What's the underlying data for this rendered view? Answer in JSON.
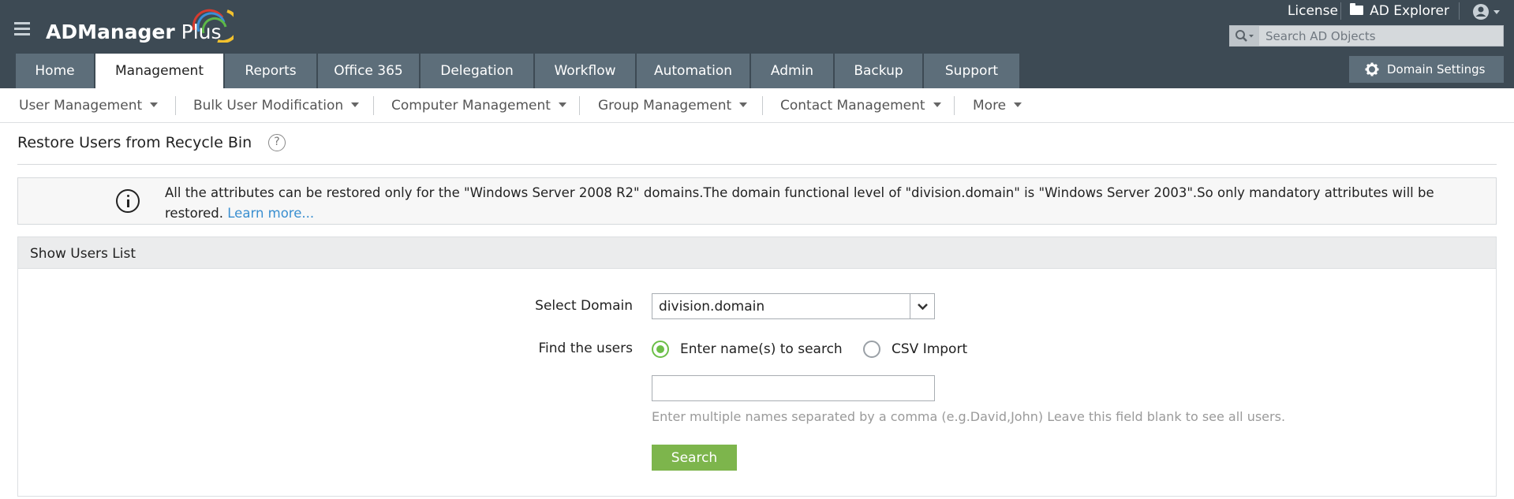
{
  "app": {
    "logo_text_bold": "ADManager",
    "logo_text_light": " Plus"
  },
  "header": {
    "license_label": "License",
    "ad_explorer_label": "AD Explorer",
    "search_placeholder": "Search AD Objects",
    "domain_settings_label": "Domain Settings",
    "tabs": [
      {
        "label": "Home",
        "active": false
      },
      {
        "label": "Management",
        "active": true
      },
      {
        "label": "Reports",
        "active": false
      },
      {
        "label": "Office 365",
        "active": false
      },
      {
        "label": "Delegation",
        "active": false
      },
      {
        "label": "Workflow",
        "active": false
      },
      {
        "label": "Automation",
        "active": false
      },
      {
        "label": "Admin",
        "active": false
      },
      {
        "label": "Backup",
        "active": false
      },
      {
        "label": "Support",
        "active": false
      }
    ]
  },
  "subnav": {
    "items": [
      {
        "label": "User Management"
      },
      {
        "label": "Bulk User Modification"
      },
      {
        "label": "Computer Management"
      },
      {
        "label": "Group Management"
      },
      {
        "label": "Contact Management"
      },
      {
        "label": "More"
      }
    ]
  },
  "page": {
    "title": "Restore Users from Recycle Bin",
    "help_glyph": "?"
  },
  "info_banner": {
    "text": "All the attributes can be restored only for the \"Windows Server 2008 R2\" domains.The domain functional level of \"division.domain\" is \"Windows Server 2003\".So only mandatory attributes will be restored.",
    "link_text": "Learn more..."
  },
  "panel": {
    "title": "Show Users List",
    "select_domain_label": "Select Domain",
    "selected_domain": "division.domain",
    "find_users_label": "Find the users",
    "radio_names_label": "Enter name(s) to search",
    "radio_csv_label": "CSV Import",
    "selected_option": "names",
    "names_value": "",
    "hint": "Enter multiple names separated by a comma (e.g.David,John) Leave this field blank to see all users.",
    "search_button": "Search"
  },
  "colors": {
    "header_bg": "#3d4a54",
    "tab_bg": "#5d6e7a",
    "accent_green": "#7db54c",
    "link_blue": "#3a8fd0"
  }
}
